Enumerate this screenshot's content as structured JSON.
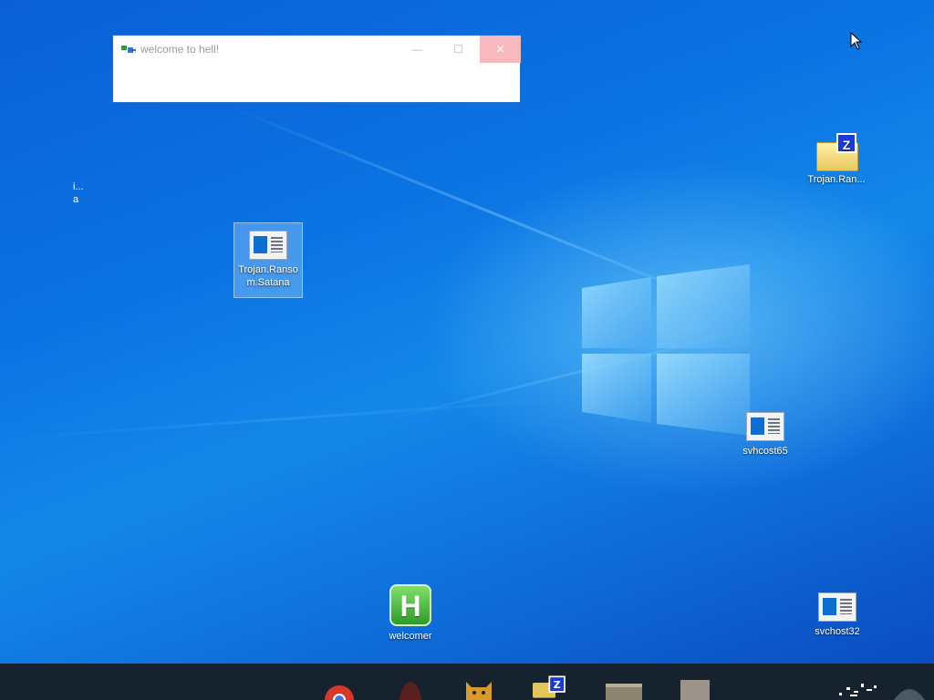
{
  "window": {
    "title": "welcome to hell!",
    "min_symbol": "—",
    "max_symbol": "☐",
    "close_symbol": "✕"
  },
  "desktop": {
    "icons": [
      {
        "label": "Trojan.Ransom.Satana",
        "icon": "application-window-icon",
        "selected": true
      },
      {
        "label": "Trojan.Ran...",
        "icon": "zip-folder-icon"
      },
      {
        "label": "svhcost65",
        "icon": "application-window-icon"
      },
      {
        "label": "welcomer",
        "icon": "hta-app-icon",
        "glyph": "H"
      },
      {
        "label": "svchost32",
        "icon": "application-window-icon"
      }
    ],
    "stray_text": [
      "i...",
      "a"
    ]
  },
  "colors": {
    "desktop_blue": "#0b74e3",
    "close_button": "#f7b9be",
    "taskbar": "#16232e"
  },
  "taskbar": {
    "items": [
      "chrome-icon",
      "red-app-icon",
      "cat-app-icon",
      "zip-folder-icon",
      "window-app-icon",
      "file-icon"
    ]
  }
}
